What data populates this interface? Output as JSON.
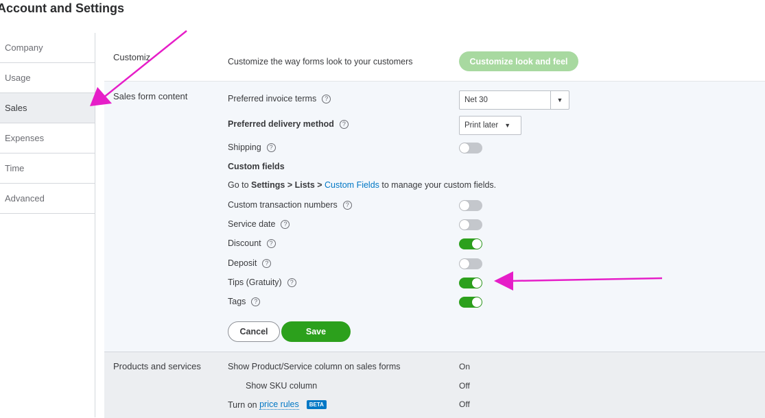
{
  "page": {
    "title": "Account and Settings"
  },
  "sidebar": {
    "items": [
      {
        "label": "Company"
      },
      {
        "label": "Usage"
      },
      {
        "label": "Sales"
      },
      {
        "label": "Expenses"
      },
      {
        "label": "Time"
      },
      {
        "label": "Advanced"
      }
    ],
    "active": "Sales"
  },
  "customize": {
    "section_label": "Customiz",
    "description": "Customize the way forms look to your customers",
    "button_label": "Customize look and feel"
  },
  "sales_form": {
    "section_label": "Sales form content",
    "invoice_terms_label": "Preferred invoice terms",
    "invoice_terms_value": "Net 30",
    "delivery_label": "Preferred delivery method",
    "delivery_value": "Print later",
    "shipping_label": "Shipping",
    "shipping_on": false,
    "custom_fields_heading": "Custom fields",
    "custom_fields_note": {
      "prefix": "Go to ",
      "path": "Settings > Lists > ",
      "link": "Custom Fields",
      "suffix": " to manage your custom fields."
    },
    "toggles": [
      {
        "label": "Custom transaction numbers",
        "on": false
      },
      {
        "label": "Service date",
        "on": false
      },
      {
        "label": "Discount",
        "on": true
      },
      {
        "label": "Deposit",
        "on": false
      },
      {
        "label": "Tips (Gratuity)",
        "on": true
      },
      {
        "label": "Tags",
        "on": true
      }
    ],
    "cancel_label": "Cancel",
    "save_label": "Save"
  },
  "products": {
    "section_label": "Products and services",
    "rows": [
      {
        "label": "Show Product/Service column on sales forms",
        "value": "On"
      },
      {
        "label": "Show SKU column",
        "value": "Off"
      },
      {
        "label_prefix": "Turn on ",
        "link": "price rules",
        "badge": "BETA",
        "value": "Off"
      }
    ]
  },
  "colors": {
    "accent": "#2ca01c",
    "link": "#0077c5",
    "annotation": "#e61ec8"
  },
  "icons": {
    "help": "question-circle-icon",
    "dropdown": "caret-down-icon"
  }
}
